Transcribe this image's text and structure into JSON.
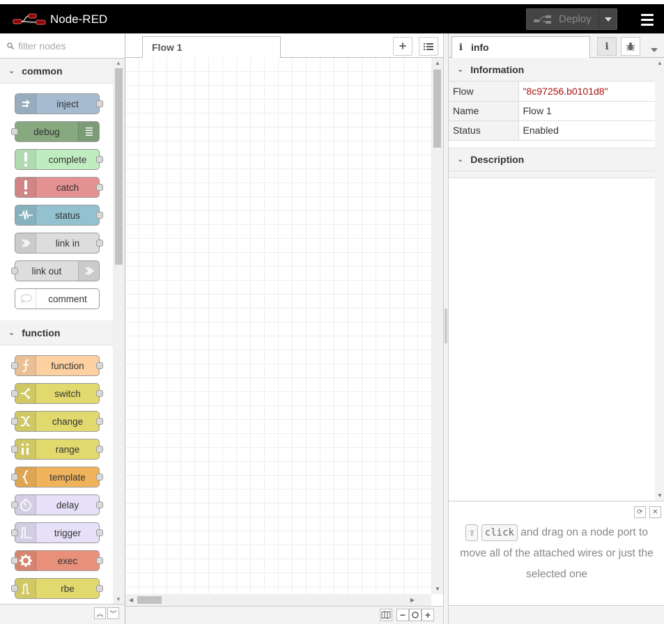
{
  "app": {
    "title": "Node-RED",
    "deploy_label": "Deploy"
  },
  "palette": {
    "search_placeholder": "filter nodes",
    "categories": [
      {
        "name": "common",
        "nodes": [
          {
            "label": "inject",
            "color": "#a6bbcf",
            "icon_side": "left",
            "in": false,
            "out": true,
            "icon": "arrow-right-icon"
          },
          {
            "label": "debug",
            "color": "#87a980",
            "icon_side": "right",
            "in": true,
            "out": false,
            "icon": "list-icon"
          },
          {
            "label": "complete",
            "color": "#c0edc0",
            "icon_side": "left",
            "in": false,
            "out": true,
            "icon": "exclamation-icon"
          },
          {
            "label": "catch",
            "color": "#e49191",
            "icon_side": "left",
            "in": false,
            "out": true,
            "icon": "exclamation-icon"
          },
          {
            "label": "status",
            "color": "#94c1d0",
            "icon_side": "left",
            "in": false,
            "out": true,
            "icon": "pulse-icon"
          },
          {
            "label": "link in",
            "color": "#dddddd",
            "icon_side": "left",
            "in": false,
            "out": true,
            "icon": "link-in-icon"
          },
          {
            "label": "link out",
            "color": "#dddddd",
            "icon_side": "right",
            "in": true,
            "out": false,
            "icon": "link-out-icon"
          },
          {
            "label": "comment",
            "color": "#ffffff",
            "icon_side": "left",
            "in": false,
            "out": false,
            "icon": "speech-bubble-icon"
          }
        ]
      },
      {
        "name": "function",
        "nodes": [
          {
            "label": "function",
            "color": "#fdd0a2",
            "icon_side": "left",
            "in": true,
            "out": true,
            "icon": "function-icon"
          },
          {
            "label": "switch",
            "color": "#e2d96e",
            "icon_side": "left",
            "in": true,
            "out": true,
            "icon": "switch-icon"
          },
          {
            "label": "change",
            "color": "#e2d96e",
            "icon_side": "left",
            "in": true,
            "out": true,
            "icon": "shuffle-icon"
          },
          {
            "label": "range",
            "color": "#e2d96e",
            "icon_side": "left",
            "in": true,
            "out": true,
            "icon": "range-icon"
          },
          {
            "label": "template",
            "color": "#f0b35c",
            "icon_side": "left",
            "in": true,
            "out": true,
            "icon": "braces-icon"
          },
          {
            "label": "delay",
            "color": "#e6e0f8",
            "icon_side": "left",
            "in": true,
            "out": true,
            "icon": "timer-icon"
          },
          {
            "label": "trigger",
            "color": "#e6e0f8",
            "icon_side": "left",
            "in": true,
            "out": true,
            "icon": "trigger-icon"
          },
          {
            "label": "exec",
            "color": "#e8907a",
            "icon_side": "left",
            "in": true,
            "out": true,
            "icon": "gear-icon"
          },
          {
            "label": "rbe",
            "color": "#e2d96e",
            "icon_side": "left",
            "in": true,
            "out": true,
            "icon": "rbe-icon"
          }
        ]
      }
    ]
  },
  "workspace": {
    "tab_label": "Flow 1"
  },
  "sidebar": {
    "tab_label": "info",
    "info_section": "Information",
    "rows": [
      {
        "key": "Flow",
        "value": "\"8c97256.b0101d8\"",
        "kind": "str"
      },
      {
        "key": "Name",
        "value": "Flow 1",
        "kind": "plain"
      },
      {
        "key": "Status",
        "value": "Enabled",
        "kind": "plain"
      }
    ],
    "description_section": "Description",
    "tip": {
      "key1": "⇧",
      "key2": "click",
      "text": " and drag on a node port to move all of the attached wires or just the selected one"
    }
  }
}
